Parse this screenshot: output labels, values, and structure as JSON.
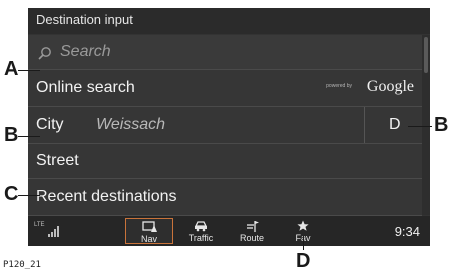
{
  "screen": {
    "title": "Destination input",
    "search": {
      "placeholder": "Search"
    },
    "online_search": {
      "label": "Online search",
      "powered_by": "powered by",
      "provider": "Google"
    },
    "city": {
      "label": "City",
      "value": "Weissach",
      "country_code": "D"
    },
    "street": {
      "label": "Street"
    },
    "recent": {
      "label": "Recent destinations"
    }
  },
  "status": {
    "network": "LTE",
    "time": "9:34"
  },
  "bottom_nav": {
    "items": [
      {
        "label": "Nav",
        "icon": "nav-icon",
        "active": true
      },
      {
        "label": "Traffic",
        "icon": "car-icon",
        "active": false
      },
      {
        "label": "Route",
        "icon": "flag-icon",
        "active": false
      },
      {
        "label": "Fav",
        "icon": "star-icon",
        "active": false
      }
    ]
  },
  "callouts": {
    "a": "A",
    "b": "B",
    "c": "C",
    "d": "D"
  },
  "figure_ref": "P120_21",
  "colors": {
    "screen_bg": "#333333",
    "active_border": "#c9733a",
    "text": "#f2f2f2"
  }
}
